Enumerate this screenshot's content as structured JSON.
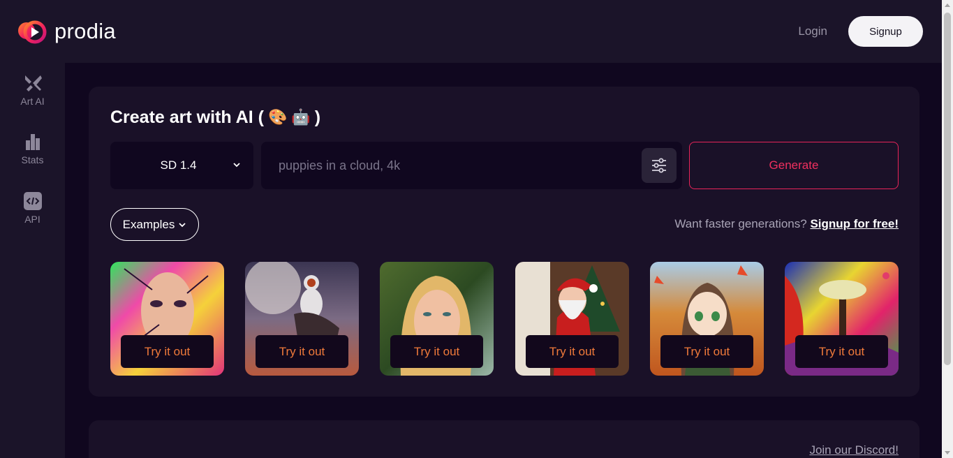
{
  "header": {
    "brand": "prodia",
    "login_label": "Login",
    "signup_label": "Signup"
  },
  "sidebar": {
    "items": [
      {
        "label": "Art AI",
        "icon": "brush-icon"
      },
      {
        "label": "Stats",
        "icon": "bar-chart-icon"
      },
      {
        "label": "API",
        "icon": "code-icon"
      }
    ]
  },
  "main": {
    "title": "Create art with AI (",
    "title_close": ")",
    "emoji_1": "🎨",
    "emoji_2": "🤖",
    "model_value": "SD 1.4",
    "prompt_placeholder": "puppies in a cloud, 4k",
    "generate_label": "Generate",
    "examples_label": "Examples",
    "faster_text": "Want faster generations?",
    "faster_link": "Signup for free!",
    "thumbnails": [
      {
        "button": "Try it out",
        "subject": "colorful woman portrait"
      },
      {
        "button": "Try it out",
        "subject": "astronaut on horse"
      },
      {
        "button": "Try it out",
        "subject": "blonde woman portrait"
      },
      {
        "button": "Try it out",
        "subject": "santa claus"
      },
      {
        "button": "Try it out",
        "subject": "anime girl autumn"
      },
      {
        "button": "Try it out",
        "subject": "psychedelic tree"
      }
    ],
    "discord_link": "Join our Discord!"
  },
  "colors": {
    "accent": "#e8245a",
    "try_text": "#f07a3a",
    "background": "#10071f",
    "panel": "#1a1128"
  }
}
